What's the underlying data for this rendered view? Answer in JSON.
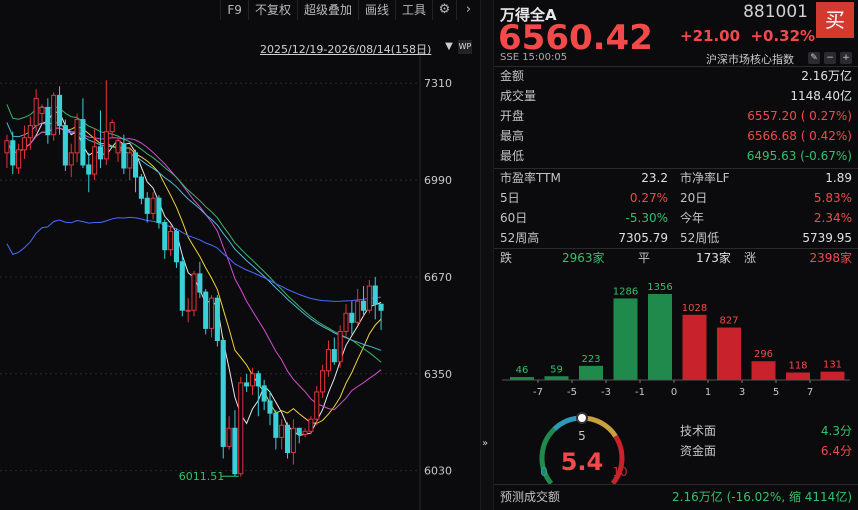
{
  "toolbar": {
    "items": [
      "F9",
      "不复权",
      "超级叠加",
      "画线",
      "工具"
    ]
  },
  "chart": {
    "range_label": "2025/12/19-2026/08/14(158日)",
    "y_ticks": [
      "7310",
      "6990",
      "6670",
      "6350",
      "6030"
    ],
    "low_annotation": "6011.51"
  },
  "chart_data": {
    "type": "candlestick",
    "y_ticks": [
      7310,
      6990,
      6670,
      6350,
      6030
    ],
    "low_marker": 6011.51,
    "candles": [
      [
        7080,
        7120,
        7030,
        7140
      ],
      [
        7120,
        7040,
        7010,
        7150
      ],
      [
        7030,
        7090,
        7010,
        7110
      ],
      [
        7090,
        7130,
        7060,
        7170
      ],
      [
        7130,
        7170,
        7090,
        7200
      ],
      [
        7170,
        7260,
        7150,
        7290
      ],
      [
        7210,
        7230,
        7180,
        7240
      ],
      [
        7230,
        7140,
        7110,
        7260
      ],
      [
        7140,
        7270,
        7120,
        7280
      ],
      [
        7270,
        7170,
        7140,
        7300
      ],
      [
        7170,
        7040,
        7020,
        7190
      ],
      [
        7040,
        7080,
        7000,
        7110
      ],
      [
        7080,
        7190,
        7050,
        7210
      ],
      [
        7190,
        7040,
        7030,
        7260
      ],
      [
        7040,
        7010,
        6950,
        7080
      ],
      [
        7010,
        7100,
        6990,
        7160
      ],
      [
        7100,
        7060,
        7030,
        7220
      ],
      [
        7060,
        7150,
        7040,
        7320
      ],
      [
        7150,
        7180,
        7130,
        7190
      ],
      [
        7080,
        7120,
        7050,
        7130
      ],
      [
        7110,
        7030,
        7010,
        7140
      ],
      [
        7030,
        7080,
        6990,
        7100
      ],
      [
        7080,
        7000,
        6950,
        7090
      ],
      [
        7000,
        6930,
        6910,
        7010
      ],
      [
        6930,
        6880,
        6850,
        6950
      ],
      [
        6880,
        6930,
        6860,
        6950
      ],
      [
        6930,
        6850,
        6830,
        6940
      ],
      [
        6850,
        6760,
        6730,
        6860
      ],
      [
        6760,
        6820,
        6740,
        6840
      ],
      [
        6820,
        6720,
        6700,
        6830
      ],
      [
        6720,
        6560,
        6540,
        6740
      ],
      [
        6560,
        6560,
        6520,
        6600
      ],
      [
        6560,
        6680,
        6540,
        6690
      ],
      [
        6680,
        6620,
        6600,
        6720
      ],
      [
        6620,
        6500,
        6480,
        6630
      ],
      [
        6500,
        6600,
        6470,
        6610
      ],
      [
        6600,
        6460,
        6440,
        6610
      ],
      [
        6460,
        6110,
        6070,
        6470
      ],
      [
        6110,
        6170,
        6100,
        6210
      ],
      [
        6170,
        6020,
        6011.51,
        6230
      ],
      [
        6020,
        6320,
        6010,
        6340
      ],
      [
        6320,
        6310,
        6290,
        6350
      ],
      [
        6310,
        6350,
        6280,
        6370
      ],
      [
        6350,
        6310,
        6210,
        6360
      ],
      [
        6310,
        6260,
        6230,
        6330
      ],
      [
        6260,
        6220,
        6180,
        6290
      ],
      [
        6220,
        6140,
        6100,
        6230
      ],
      [
        6140,
        6180,
        6100,
        6200
      ],
      [
        6180,
        6090,
        6070,
        6190
      ],
      [
        6090,
        6170,
        6050,
        6200
      ],
      [
        6170,
        6150,
        6120,
        6170
      ],
      [
        6150,
        6160,
        6140,
        6170
      ],
      [
        6160,
        6200,
        6150,
        6210
      ],
      [
        6200,
        6290,
        6180,
        6310
      ],
      [
        6290,
        6360,
        6270,
        6380
      ],
      [
        6360,
        6430,
        6340,
        6460
      ],
      [
        6430,
        6390,
        6380,
        6470
      ],
      [
        6390,
        6490,
        6370,
        6510
      ],
      [
        6490,
        6550,
        6470,
        6580
      ],
      [
        6550,
        6520,
        6480,
        6590
      ],
      [
        6520,
        6590,
        6510,
        6630
      ],
      [
        6590,
        6560,
        6540,
        6640
      ],
      [
        6560,
        6640,
        6550,
        6660
      ],
      [
        6640,
        6580,
        6530,
        6670
      ],
      [
        6580,
        6560,
        6495,
        6580
      ]
    ]
  },
  "quote": {
    "name": "万得全A",
    "code": "881001",
    "buy_label": "买",
    "price": "6560.42",
    "change": "+21.00",
    "change_pct": "+0.32%",
    "exchange_time": "SSE  15:00:05",
    "index_type": "沪深市场核心指数"
  },
  "stats": [
    {
      "label": "金额",
      "value": "2.16万亿",
      "color": "wt"
    },
    {
      "label": "成交量",
      "value": "1148.40亿",
      "color": "wt"
    },
    {
      "label": "开盘",
      "value": "6557.20 ( 0.27%)",
      "color": "up"
    },
    {
      "label": "最高",
      "value": "6566.68 ( 0.42%)",
      "color": "up"
    },
    {
      "label": "最低",
      "value": "6495.63 (-0.67%)",
      "color": "dn"
    }
  ],
  "stats2": [
    {
      "l_label": "市盈率TTM",
      "l_value": "23.2",
      "l_color": "wt",
      "r_label": "市净率LF",
      "r_value": "1.89",
      "r_color": "wt"
    },
    {
      "l_label": "5日",
      "l_value": "0.27%",
      "l_color": "up",
      "r_label": "20日",
      "r_value": "5.83%",
      "r_color": "up"
    },
    {
      "l_label": "60日",
      "l_value": "-5.30%",
      "l_color": "dn",
      "r_label": "今年",
      "r_value": "2.34%",
      "r_color": "up"
    },
    {
      "l_label": "52周高",
      "l_value": "7305.79",
      "l_color": "wt",
      "r_label": "52周低",
      "r_value": "5739.95",
      "r_color": "wt"
    }
  ],
  "breadth": {
    "down_label": "跌",
    "down_value": "2963家",
    "flat_label": "平",
    "flat_value": "173家",
    "up_label": "涨",
    "up_value": "2398家"
  },
  "distribution": {
    "values": [
      46,
      59,
      223,
      1286,
      1356,
      1028,
      827,
      296,
      118,
      131
    ],
    "colors": [
      "#1f8a4c",
      "#1f8a4c",
      "#1f8a4c",
      "#1f8a4c",
      "#1f8a4c",
      "#c8232c",
      "#c8232c",
      "#c8232c",
      "#c8232c",
      "#c8232c"
    ],
    "label_colors": [
      "#2fc26b",
      "#2fc26b",
      "#2fc26b",
      "#2fc26b",
      "#2fc26b",
      "#f24a4a",
      "#f24a4a",
      "#f24a4a",
      "#f24a4a",
      "#f24a4a"
    ],
    "x_labels": [
      "-7",
      "-5",
      "-3",
      "-1",
      "0",
      "1",
      "3",
      "5",
      "7"
    ]
  },
  "gauge": {
    "value": "5.4",
    "min": "0",
    "mid": "5",
    "max": "10",
    "level": 0.54
  },
  "scores": [
    {
      "label": "技术面",
      "value": "4.3分",
      "color": "dn"
    },
    {
      "label": "资金面",
      "value": "6.4分",
      "color": "up"
    }
  ],
  "forecast": {
    "label": "预测成交额",
    "value": "2.16万亿 (-16.02%, 缩 4114亿)"
  }
}
